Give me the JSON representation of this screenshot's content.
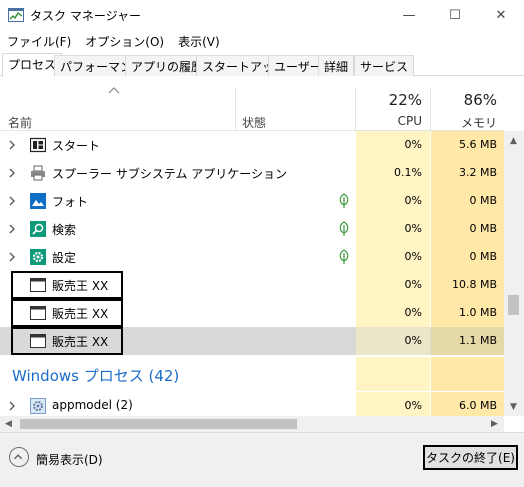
{
  "window": {
    "title": "タスク マネージャー",
    "minimize": "—",
    "maximize": "☐",
    "close": "✕"
  },
  "menu": [
    "ファイル(F)",
    "オプション(O)",
    "表示(V)"
  ],
  "tabs": [
    "プロセス",
    "パフォーマンス",
    "アプリの履歴",
    "スタートアップ",
    "ユーザー",
    "詳細",
    "サービス"
  ],
  "header": {
    "name": "名前",
    "state": "状態",
    "cpu_pct": "22%",
    "cpu_label": "CPU",
    "mem_pct": "86%",
    "mem_label": "メモリ"
  },
  "rows": [
    {
      "name": "スタート",
      "icon": "start-app-icon",
      "cpu": "0%",
      "mem": "5.6 MB",
      "leaf": false
    },
    {
      "name": "スプーラー サブシステム アプリケーション",
      "icon": "printer-icon",
      "cpu": "0.1%",
      "mem": "3.2 MB",
      "leaf": false
    },
    {
      "name": "フォト",
      "icon": "photos-icon",
      "cpu": "0%",
      "mem": "0 MB",
      "leaf": true
    },
    {
      "name": "検索",
      "icon": "search-icon",
      "cpu": "0%",
      "mem": "0 MB",
      "leaf": true
    },
    {
      "name": "設定",
      "icon": "settings-gear-icon",
      "cpu": "0%",
      "mem": "0 MB",
      "leaf": true
    },
    {
      "name": "販売王 XX",
      "icon": "app-window-icon",
      "cpu": "0%",
      "mem": "10.8 MB",
      "leaf": false
    },
    {
      "name": "販売王 XX",
      "icon": "app-window-icon",
      "cpu": "0%",
      "mem": "1.0 MB",
      "leaf": false
    },
    {
      "name": "販売王 XX",
      "icon": "app-window-icon",
      "cpu": "0%",
      "mem": "1.1 MB",
      "leaf": false
    }
  ],
  "section": {
    "title": "Windows プロセス (42)"
  },
  "section_rows": [
    {
      "name": "appmodel (2)",
      "icon": "service-gear-icon",
      "cpu": "0%",
      "mem": "6.0 MB"
    }
  ],
  "footer": {
    "collapse": "簡易表示(D)",
    "end_task": "タスクの終了(E)"
  },
  "colors": {
    "cpu_column": "#fff4c4",
    "mem_column": "#ffe8a8",
    "section_blue": "#1a6cc8",
    "selected_row": "#d9d9d9"
  }
}
